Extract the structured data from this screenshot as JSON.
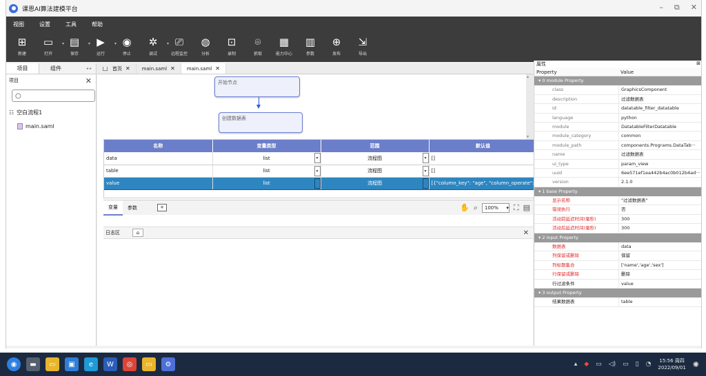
{
  "app": {
    "title": "课恩AI算法建模平台"
  },
  "menu": [
    "视图",
    "设置",
    "工具",
    "帮助"
  ],
  "toolbar": [
    {
      "icon": "new-icon",
      "glyph": "⊞",
      "label": "新建",
      "dd": false
    },
    {
      "icon": "open-icon",
      "glyph": "▭",
      "label": "打开",
      "dd": true
    },
    {
      "icon": "save-icon",
      "glyph": "▤",
      "label": "保存",
      "dd": true
    },
    {
      "icon": "run-icon",
      "glyph": "▶",
      "label": "运行",
      "dd": true
    },
    {
      "icon": "stop-icon",
      "glyph": "◉",
      "label": "停止",
      "dd": false
    },
    {
      "icon": "debug-icon",
      "glyph": "✲",
      "label": "调试",
      "dd": true
    },
    {
      "icon": "remote-monitor-icon",
      "glyph": "⎚",
      "label": "远程监控",
      "dd": false
    },
    {
      "icon": "analyze-icon",
      "glyph": "◍",
      "label": "分析",
      "dd": false
    },
    {
      "icon": "record-icon",
      "glyph": "⊡",
      "label": "录制",
      "dd": false
    },
    {
      "icon": "capture-icon",
      "glyph": "⌾",
      "label": "抓取",
      "dd": false
    },
    {
      "icon": "capability-center-icon",
      "glyph": "▦",
      "label": "能力中心",
      "dd": false
    },
    {
      "icon": "params-icon",
      "glyph": "▥",
      "label": "参数",
      "dd": false
    },
    {
      "icon": "publish-icon",
      "glyph": "⊕",
      "label": "发布",
      "dd": false
    },
    {
      "icon": "export-icon",
      "glyph": "⇲",
      "label": "导出",
      "dd": false
    }
  ],
  "left_panel": {
    "tabs": [
      "项目",
      "组件"
    ],
    "side_glyph": "◂ ▸",
    "header": "项目",
    "close": "✕",
    "search_glyph": "○",
    "tree": {
      "root": "空白流程1",
      "file": "main.saml"
    }
  },
  "editor": {
    "tabs": [
      {
        "label": "首页",
        "close": "✕"
      },
      {
        "label": "main.saml",
        "close": "✕"
      },
      {
        "label": "main.saml",
        "close": "✕"
      }
    ],
    "nodes": [
      "开始节点",
      "创建数据表"
    ]
  },
  "grid": {
    "headers": [
      "名称",
      "变量类型",
      "范围",
      "默认值"
    ],
    "rows": [
      {
        "name": "data",
        "type": "list",
        "scope": "流程图",
        "default": "[]"
      },
      {
        "name": "table",
        "type": "list",
        "scope": "流程图",
        "default": "[]"
      },
      {
        "name": "value",
        "type": "list",
        "scope": "流程图",
        "default": "[{\"column_key\": \"age\", \"column_operate\":···"
      }
    ]
  },
  "bottom_tabs": [
    "变量",
    "参数"
  ],
  "add_label": "+",
  "zoom": {
    "value": "100%"
  },
  "log": {
    "title": "日志区",
    "clear_glyph": "⌂",
    "close": "✕"
  },
  "properties": {
    "title": "属性",
    "close": "⊠",
    "col_property": "Property",
    "col_value": "Value",
    "sections": [
      {
        "title": "0 module Property",
        "rows": [
          {
            "k": "class",
            "v": "GraphicsComponent",
            "style": "gray"
          },
          {
            "k": "description",
            "v": "过滤数据表",
            "style": "gray"
          },
          {
            "k": "id",
            "v": "datatable_filter_datatable",
            "style": "gray"
          },
          {
            "k": "language",
            "v": "python",
            "style": "gray"
          },
          {
            "k": "module",
            "v": "DatatableFilterDatatable",
            "style": "gray"
          },
          {
            "k": "module_category",
            "v": "common",
            "style": "gray"
          },
          {
            "k": "module_path",
            "v": "components.Programs.DataTab···",
            "style": "gray"
          },
          {
            "k": "name",
            "v": "过滤数据表",
            "style": "gray"
          },
          {
            "k": "ui_type",
            "v": "param_view",
            "style": "gray"
          },
          {
            "k": "uuid",
            "v": "6ee571ef1ea442b4ac0b012b4ad···",
            "style": "gray"
          },
          {
            "k": "version",
            "v": "2.1.0",
            "style": "gray"
          }
        ]
      },
      {
        "title": "1 base Property",
        "rows": [
          {
            "k": "显示名称",
            "v": "\"过滤数据表\"",
            "style": "red"
          },
          {
            "k": "错误执行",
            "v": "否",
            "style": "red"
          },
          {
            "k": "活动前延迟时间(毫秒)",
            "v": "300",
            "style": "red"
          },
          {
            "k": "活动后延迟时间(毫秒)",
            "v": "300",
            "style": "red"
          }
        ]
      },
      {
        "title": "2 input Property",
        "rows": [
          {
            "k": "数据表",
            "v": "data",
            "style": "red"
          },
          {
            "k": "列保留或删除",
            "v": "保留",
            "style": "red"
          },
          {
            "k": "列标题集合",
            "v": "['name','age','sex']",
            "style": "red"
          },
          {
            "k": "行保留或删除",
            "v": "删除",
            "style": "red"
          },
          {
            "k": "行过滤条件",
            "v": "value",
            "style": "dark"
          }
        ]
      },
      {
        "title": "3 output Property",
        "rows": [
          {
            "k": "结果数据表",
            "v": "table",
            "style": "dark"
          }
        ]
      }
    ]
  },
  "taskbar": {
    "apps": [
      {
        "icon": "start-icon",
        "color": "#2d7fe0",
        "glyph": "◉"
      },
      {
        "icon": "task-view-icon",
        "color": "#55606e",
        "glyph": "▬"
      },
      {
        "icon": "file-explorer-icon",
        "color": "#e8b52d",
        "glyph": "▭"
      },
      {
        "icon": "store-icon",
        "color": "#2f7ed8",
        "glyph": "▣"
      },
      {
        "icon": "edge-icon",
        "color": "#1e9ad6",
        "glyph": "e"
      },
      {
        "icon": "word-icon",
        "color": "#2b5cb8",
        "glyph": "W"
      },
      {
        "icon": "chrome-icon",
        "color": "#db4437",
        "glyph": "◎"
      },
      {
        "icon": "folder-icon",
        "color": "#e8b52d",
        "glyph": "▭"
      },
      {
        "icon": "modeling-app-icon",
        "color": "#4d6fd8",
        "glyph": "⚙"
      }
    ],
    "time": "15:56 周四",
    "date": "2022/09/01"
  }
}
